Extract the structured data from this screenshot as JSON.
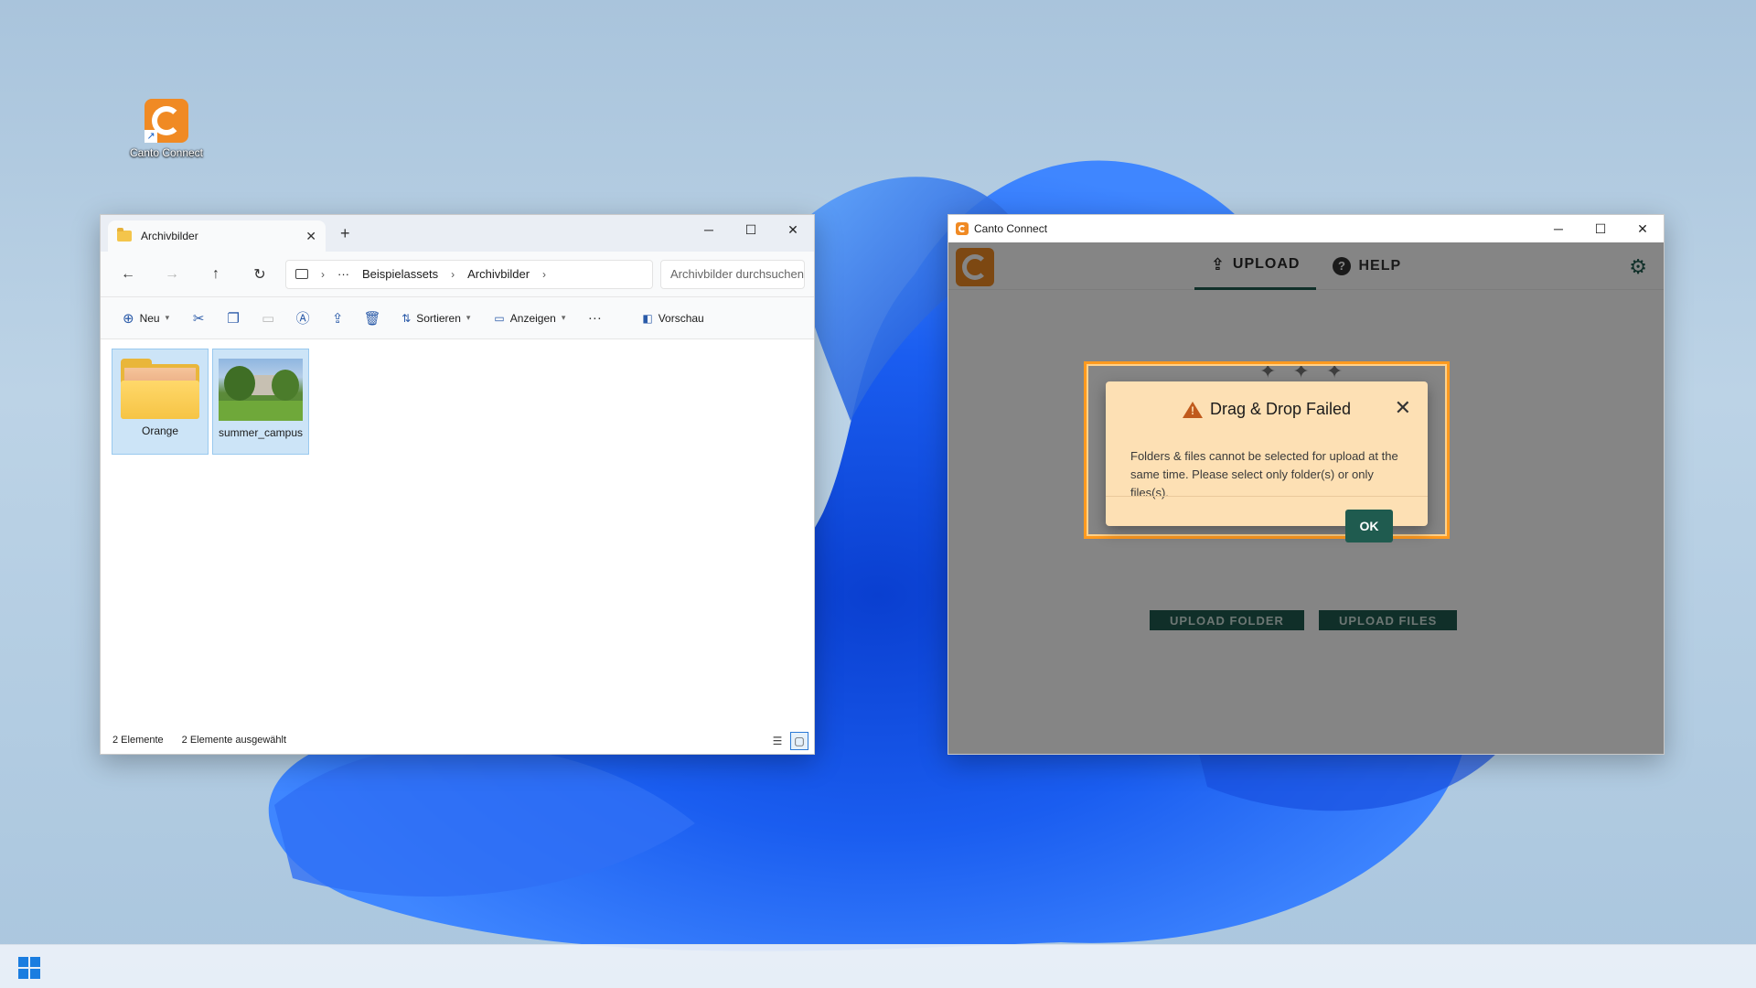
{
  "desktop": {
    "icon_label": "Canto Connect"
  },
  "explorer": {
    "tab_title": "Archivbilder",
    "breadcrumb": [
      "Beispielassets",
      "Archivbilder"
    ],
    "breadcrumb_overflow": "···",
    "search_placeholder": "Archivbilder durchsuchen",
    "toolbar": {
      "new_label": "Neu",
      "sort_label": "Sortieren",
      "view_label": "Anzeigen",
      "more_label": "···",
      "preview_label": "Vorschau"
    },
    "items": [
      {
        "name": "Orange",
        "type": "folder"
      },
      {
        "name": "summer_campus",
        "type": "image"
      }
    ],
    "status": {
      "count": "2 Elemente",
      "selected": "2 Elemente ausgewählt"
    }
  },
  "canto": {
    "window_title": "Canto Connect",
    "tabs": [
      {
        "label": "UPLOAD",
        "icon": "upload-icon",
        "active": true
      },
      {
        "label": "HELP",
        "icon": "help-icon",
        "active": false
      }
    ],
    "bg_buttons": [
      "UPLOAD FOLDER",
      "UPLOAD FILES"
    ],
    "dialog": {
      "title": "Drag & Drop Failed",
      "message": "Folders & files cannot be selected for upload at the same time. Please select only folder(s) or only files(s).",
      "ok_label": "OK"
    }
  },
  "colors": {
    "accent_green": "#1f5b4f",
    "canto_orange": "#f08a24",
    "drop_highlight": "#ff9a1f",
    "dialog_bg": "#fde0b4"
  }
}
